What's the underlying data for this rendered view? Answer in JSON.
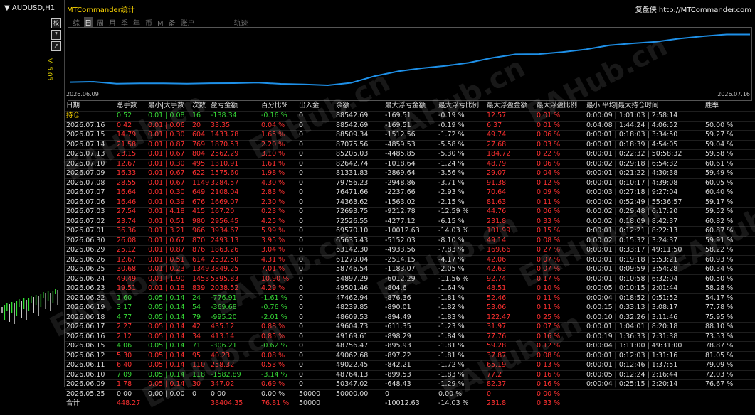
{
  "chart_window": {
    "symbol_title": "▼ AUDUSD,H1",
    "price_label": "V: 5.05",
    "side_buttons": [
      "校",
      "?",
      "↗"
    ]
  },
  "panel": {
    "title": "MTCommander统计",
    "brand": "复盘侠 http://MTCommander.com",
    "tabs": [
      {
        "label": "综",
        "active": false
      },
      {
        "label": "日",
        "active": true
      },
      {
        "label": "周",
        "active": false
      },
      {
        "label": "月",
        "active": false
      },
      {
        "label": "季",
        "active": false
      },
      {
        "label": "年",
        "active": false
      },
      {
        "label": "币",
        "active": false
      },
      {
        "label": "M",
        "active": false
      },
      {
        "label": "备",
        "active": false
      },
      {
        "label": "账户",
        "active": false
      },
      {
        "label": "轨迹",
        "active": false
      }
    ],
    "watermark": "EAHub.cn"
  },
  "equity_chart": {
    "start_date": "2026.06.09",
    "end_date": "2026.07.16",
    "line_color": "#1e90e8",
    "balances": [
      50000.0,
      50347.02,
      48764.13,
      49022.45,
      49062.68,
      48756.47,
      49169.61,
      49191.73,
      49604.73,
      48609.53,
      48239.85,
      47462.94,
      49501.46,
      54897.29,
      58746.54,
      61279.04,
      63142.3,
      65635.43,
      69570.1,
      72526.55,
      72693.75,
      74363.62,
      76471.66,
      79756.23,
      81331.83,
      82642.74,
      85205.03,
      87075.56,
      88509.34,
      88542.69
    ]
  },
  "table": {
    "headers": [
      "日期",
      "总手数",
      "最小|大手数",
      "次数",
      "盈亏金额",
      "百分比%",
      "出入金",
      "余额",
      "最大浮亏金额",
      "最大浮亏比例",
      "最大浮盈金额",
      "最大浮盈比例",
      "最小|平均|最大持仓时间",
      "胜率"
    ],
    "rows": [
      [
        "持仓",
        "0.52",
        "0.01 | 0.08",
        "16",
        "-138.34",
        "-0.16 %",
        "0",
        "88542.69",
        "-169.51",
        "-0.19 %",
        "12.57",
        "0.01 %",
        "0:00:09 | 1:01:03 | 2:58:14",
        ""
      ],
      [
        "2026.07.16",
        "0.42",
        "0.01 | 0.06",
        "20",
        "33.35",
        "0.04 %",
        "0",
        "88542.69",
        "-169.51",
        "-0.19 %",
        "6.37",
        "0.01 %",
        "0:04:08 | 1:44:24 | 4:06:52",
        "50.00 %"
      ],
      [
        "2026.07.15",
        "14.79",
        "0.01 | 0.30",
        "604",
        "1433.78",
        "1.65 %",
        "0",
        "88509.34",
        "-1512.56",
        "-1.72 %",
        "49.74",
        "0.06 %",
        "0:00:01 | 0:18:03 | 3:34:50",
        "59.27 %"
      ],
      [
        "2026.07.14",
        "21.58",
        "0.01 | 0.87",
        "769",
        "1870.53",
        "2.20 %",
        "0",
        "87075.56",
        "-4859.53",
        "-5.58 %",
        "27.68",
        "0.03 %",
        "0:00:01 | 0:18:39 | 4:54:05",
        "59.04 %"
      ],
      [
        "2026.07.13",
        "23.15",
        "0.01 | 0.67",
        "804",
        "2562.29",
        "3.10 %",
        "0",
        "85205.03",
        "-4485.85",
        "-5.30 %",
        "184.72",
        "0.22 %",
        "0:00:01 | 0:22:32 | 50:58:32",
        "59.58 %"
      ],
      [
        "2026.07.10",
        "12.67",
        "0.01 | 0.30",
        "495",
        "1310.91",
        "1.61 %",
        "0",
        "82642.74",
        "-1018.64",
        "-1.24 %",
        "48.79",
        "0.06 %",
        "0:00:02 | 0:29:18 | 6:54:32",
        "60.61 %"
      ],
      [
        "2026.07.09",
        "16.33",
        "0.01 | 0.67",
        "622",
        "1575.60",
        "1.98 %",
        "0",
        "81331.83",
        "-2869.64",
        "-3.56 %",
        "29.07",
        "0.04 %",
        "0:00:01 | 0:21:22 | 4:30:38",
        "59.49 %"
      ],
      [
        "2026.07.08",
        "28.55",
        "0.01 | 0.67",
        "1149",
        "3284.57",
        "4.30 %",
        "0",
        "79756.23",
        "-2948.86",
        "-3.71 %",
        "91.38",
        "0.12 %",
        "0:00:01 | 0:10:17 | 4:39:08",
        "60.05 %"
      ],
      [
        "2026.07.07",
        "16.64",
        "0.01 | 0.30",
        "649",
        "2108.04",
        "2.83 %",
        "0",
        "76471.66",
        "-2237.66",
        "-2.93 %",
        "70.64",
        "0.09 %",
        "0:00:03 | 0:27:18 | 9:27:04",
        "60.40 %"
      ],
      [
        "2026.07.06",
        "16.46",
        "0.01 | 0.39",
        "676",
        "1669.07",
        "2.30 %",
        "0",
        "74363.62",
        "-1563.02",
        "-2.15 %",
        "81.63",
        "0.11 %",
        "0:00:02 | 0:52:49 | 55:36:57",
        "59.17 %"
      ],
      [
        "2026.07.03",
        "27.54",
        "0.01 | 4.18",
        "415",
        "167.20",
        "0.23 %",
        "0",
        "72693.75",
        "-9212.78",
        "-12.59 %",
        "44.76",
        "0.06 %",
        "0:00:02 | 0:29:48 | 6:17:20",
        "59.52 %"
      ],
      [
        "2026.07.02",
        "23.74",
        "0.01 | 0.51",
        "980",
        "2956.45",
        "4.25 %",
        "0",
        "72526.55",
        "-4277.12",
        "-6.15 %",
        "231.8",
        "0.33 %",
        "0:00:02 | 0:18:09 | 8:42:37",
        "60.82 %"
      ],
      [
        "2026.07.01",
        "36.36",
        "0.01 | 3.21",
        "966",
        "3934.67",
        "5.99 %",
        "0",
        "69570.10",
        "-10012.63",
        "-14.03 %",
        "101.99",
        "0.15 %",
        "0:00:01 | 0:12:21 | 8:22:13",
        "60.87 %"
      ],
      [
        "2026.06.30",
        "26.08",
        "0.01 | 0.67",
        "870",
        "2493.13",
        "3.95 %",
        "0",
        "65635.43",
        "-5152.03",
        "-8.10 %",
        "49.14",
        "0.08 %",
        "0:00:02 | 0:15:32 | 3:24:37",
        "59.91 %"
      ],
      [
        "2026.06.29",
        "25.12",
        "0.01 | 0.87",
        "876",
        "1863.26",
        "3.04 %",
        "0",
        "63142.30",
        "-4933.56",
        "-7.83 %",
        "169.66",
        "0.27 %",
        "0:00:01 | 0:33:17 | 49:11:50",
        "58.22 %"
      ],
      [
        "2026.06.26",
        "12.67",
        "0.01 | 0.51",
        "614",
        "2532.50",
        "4.31 %",
        "0",
        "61279.04",
        "-2514.15",
        "-4.17 %",
        "42.06",
        "0.07 %",
        "0:00:01 | 0:19:18 | 5:53:21",
        "60.93 %"
      ],
      [
        "2026.06.25",
        "30.68",
        "0.01 | 0.23",
        "1349",
        "3849.25",
        "7.01 %",
        "0",
        "58746.54",
        "-1183.07",
        "-2.05 %",
        "42.63",
        "0.07 %",
        "0:00:01 | 0:09:59 | 3:54:28",
        "60.34 %"
      ],
      [
        "2026.06.24",
        "49.49",
        "0.01 | 1.90",
        "1453",
        "5395.83",
        "10.90 %",
        "0",
        "54897.29",
        "-6012.29",
        "-11.56 %",
        "92.74",
        "0.17 %",
        "0:00:01 | 0:10:58 | 6:32:04",
        "60.50 %"
      ],
      [
        "2026.06.23",
        "19.51",
        "0.01 | 0.18",
        "839",
        "2038.52",
        "4.29 %",
        "0",
        "49501.46",
        "-804.6",
        "-1.64 %",
        "48.51",
        "0.10 %",
        "0:00:05 | 0:10:15 | 2:01:44",
        "58.28 %"
      ],
      [
        "2026.06.22",
        "1.60",
        "0.05 | 0.14",
        "24",
        "-776.91",
        "-1.61 %",
        "0",
        "47462.94",
        "-876.36",
        "-1.81 %",
        "52.46",
        "0.11 %",
        "0:00:04 | 0:18:52 | 0:51:52",
        "54.17 %"
      ],
      [
        "2026.06.19",
        "3.17",
        "0.05 | 0.14",
        "54",
        "-369.68",
        "-0.76 %",
        "0",
        "48239.85",
        "-890.01",
        "-1.82 %",
        "53.06",
        "0.11 %",
        "0:00:15 | 0:33:13 | 3:08:17",
        "77.78 %"
      ],
      [
        "2026.06.18",
        "4.77",
        "0.05 | 0.14",
        "79",
        "-995.20",
        "-2.01 %",
        "0",
        "48609.53",
        "-894.49",
        "-1.83 %",
        "122.47",
        "0.25 %",
        "0:00:10 | 0:32:26 | 3:11:46",
        "75.95 %"
      ],
      [
        "2026.06.17",
        "2.27",
        "0.05 | 0.14",
        "42",
        "435.12",
        "0.88 %",
        "0",
        "49604.73",
        "-611.35",
        "-1.23 %",
        "31.97",
        "0.07 %",
        "0:00:01 | 1:04:01 | 8:20:18",
        "88.10 %"
      ],
      [
        "2026.06.16",
        "2.12",
        "0.05 | 0.14",
        "34",
        "413.14",
        "0.85 %",
        "0",
        "49169.61",
        "-898.29",
        "-1.84 %",
        "77.76",
        "0.16 %",
        "0:00:19 | 1:36:33 | 7:31:38",
        "73.53 %"
      ],
      [
        "2026.06.15",
        "4.06",
        "0.05 | 0.14",
        "71",
        "-306.21",
        "-0.62 %",
        "0",
        "48756.47",
        "-895.93",
        "-1.81 %",
        "59.28",
        "0.12 %",
        "0:00:04 | 1:11:00 | 49:31:00",
        "78.87 %"
      ],
      [
        "2026.06.12",
        "5.30",
        "0.05 | 0.14",
        "95",
        "40.23",
        "0.08 %",
        "0",
        "49062.68",
        "-897.22",
        "-1.81 %",
        "37.87",
        "0.08 %",
        "0:00:01 | 0:12:03 | 1:31:16",
        "81.05 %"
      ],
      [
        "2026.06.11",
        "6.40",
        "0.05 | 0.14",
        "110",
        "258.32",
        "0.53 %",
        "0",
        "49022.45",
        "-842.21",
        "-1.72 %",
        "65.19",
        "0.13 %",
        "0:00:01 | 0:12:46 | 1:37:51",
        "79.09 %"
      ],
      [
        "2026.06.10",
        "7.09",
        "0.05 | 0.14",
        "118",
        "-1582.89",
        "-3.14 %",
        "0",
        "48764.13",
        "-899.53",
        "-1.83 %",
        "77.2",
        "0.16 %",
        "0:00:05 | 0:12:24 | 2:16:44",
        "72.03 %"
      ],
      [
        "2026.06.09",
        "1.78",
        "0.05 | 0.14",
        "30",
        "347.02",
        "0.69 %",
        "0",
        "50347.02",
        "-648.43",
        "-1.29 %",
        "82.37",
        "0.16 %",
        "0:00:04 | 0:25:15 | 2:20:14",
        "76.67 %"
      ],
      [
        "2026.05.25",
        "0.00",
        "0.00 | 0.00",
        "0",
        "0.00",
        "0.00 %",
        "50000",
        "50000.00",
        "0",
        "0.00 %",
        "0",
        "0.00 %",
        "",
        ""
      ]
    ],
    "total": [
      "合计",
      "448.27",
      "",
      "",
      "38404.35",
      "76.81 %",
      "50000",
      "",
      "-10012.63",
      "-14.03 %",
      "231.8",
      "0.33 %",
      "",
      ""
    ]
  }
}
